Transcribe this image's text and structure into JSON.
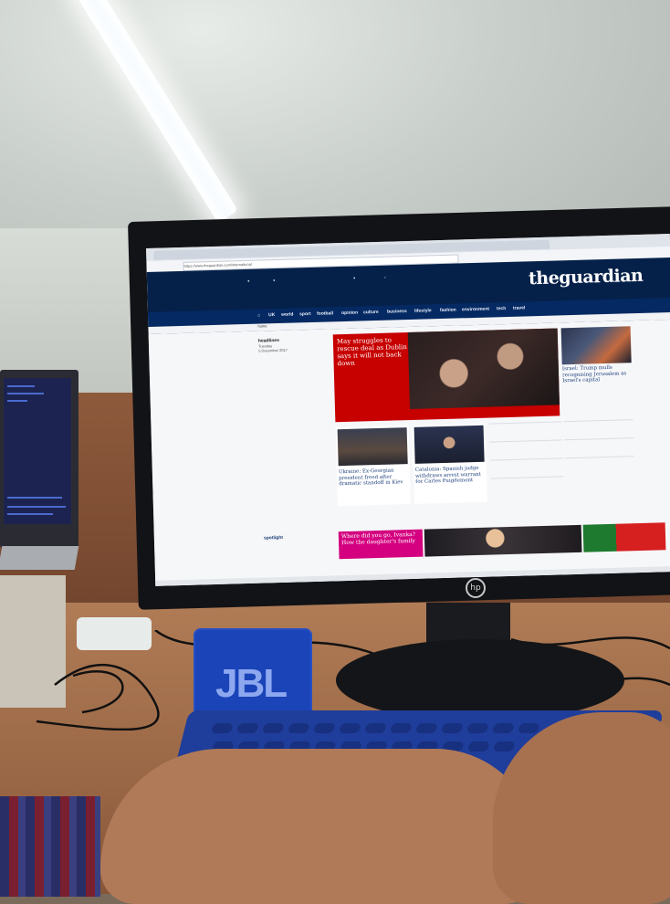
{
  "browser": {
    "tabs": [
      "",
      "",
      "",
      "",
      "",
      "",
      "",
      "",
      ""
    ],
    "url": "https://www.theguardian.com/international"
  },
  "guardian": {
    "logo": "theguardian",
    "edition": "",
    "nav": [
      "UK",
      "world",
      "sport",
      "football",
      "opinion",
      "culture",
      "business",
      "lifestyle",
      "fashion",
      "environment",
      "tech",
      "travel"
    ],
    "home_label": "home",
    "section": {
      "title": "headlines",
      "day": "Tuesday",
      "date": "5 December 2017"
    },
    "lead": {
      "title": "May struggles to rescue deal as Dublin says it will not back down"
    },
    "side": {
      "title": "Israel: Trump mulls recognising Jerusalem as Israel's capital"
    },
    "cards": [
      {
        "title": "Ukraine: Ex-Georgian president freed after dramatic standoff in Kiev"
      },
      {
        "title": "Catalonia: Spanish judge withdraws arrest warrant for Carles Puigdemont"
      }
    ],
    "spotlight": {
      "label": "spotlight",
      "text": "Where did you go, Ivanka? How the daughter's family"
    }
  },
  "colors": {
    "guardian_blue": "#052962",
    "lead_red": "#c70000",
    "spotlight_pink": "#d4007f",
    "jbl_blue": "#1a44b8",
    "keyboard_blue": "#1f3d9a"
  },
  "objects": {
    "speaker_brand": "JBL"
  }
}
